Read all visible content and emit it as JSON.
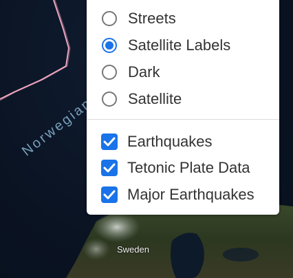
{
  "map": {
    "sea_label": "Norwegian Sea",
    "country_label": "Sweden"
  },
  "layer_control": {
    "base_layers": [
      {
        "label": "Streets",
        "checked": false
      },
      {
        "label": "Satellite Labels",
        "checked": true
      },
      {
        "label": "Dark",
        "checked": false
      },
      {
        "label": "Satellite",
        "checked": false
      }
    ],
    "overlays": [
      {
        "label": "Earthquakes",
        "checked": true
      },
      {
        "label": "Tetonic Plate Data",
        "checked": true
      },
      {
        "label": "Major Earthquakes",
        "checked": true
      }
    ]
  },
  "colors": {
    "accent": "#1a73e8",
    "plate_boundary": "#f0a6c0"
  }
}
